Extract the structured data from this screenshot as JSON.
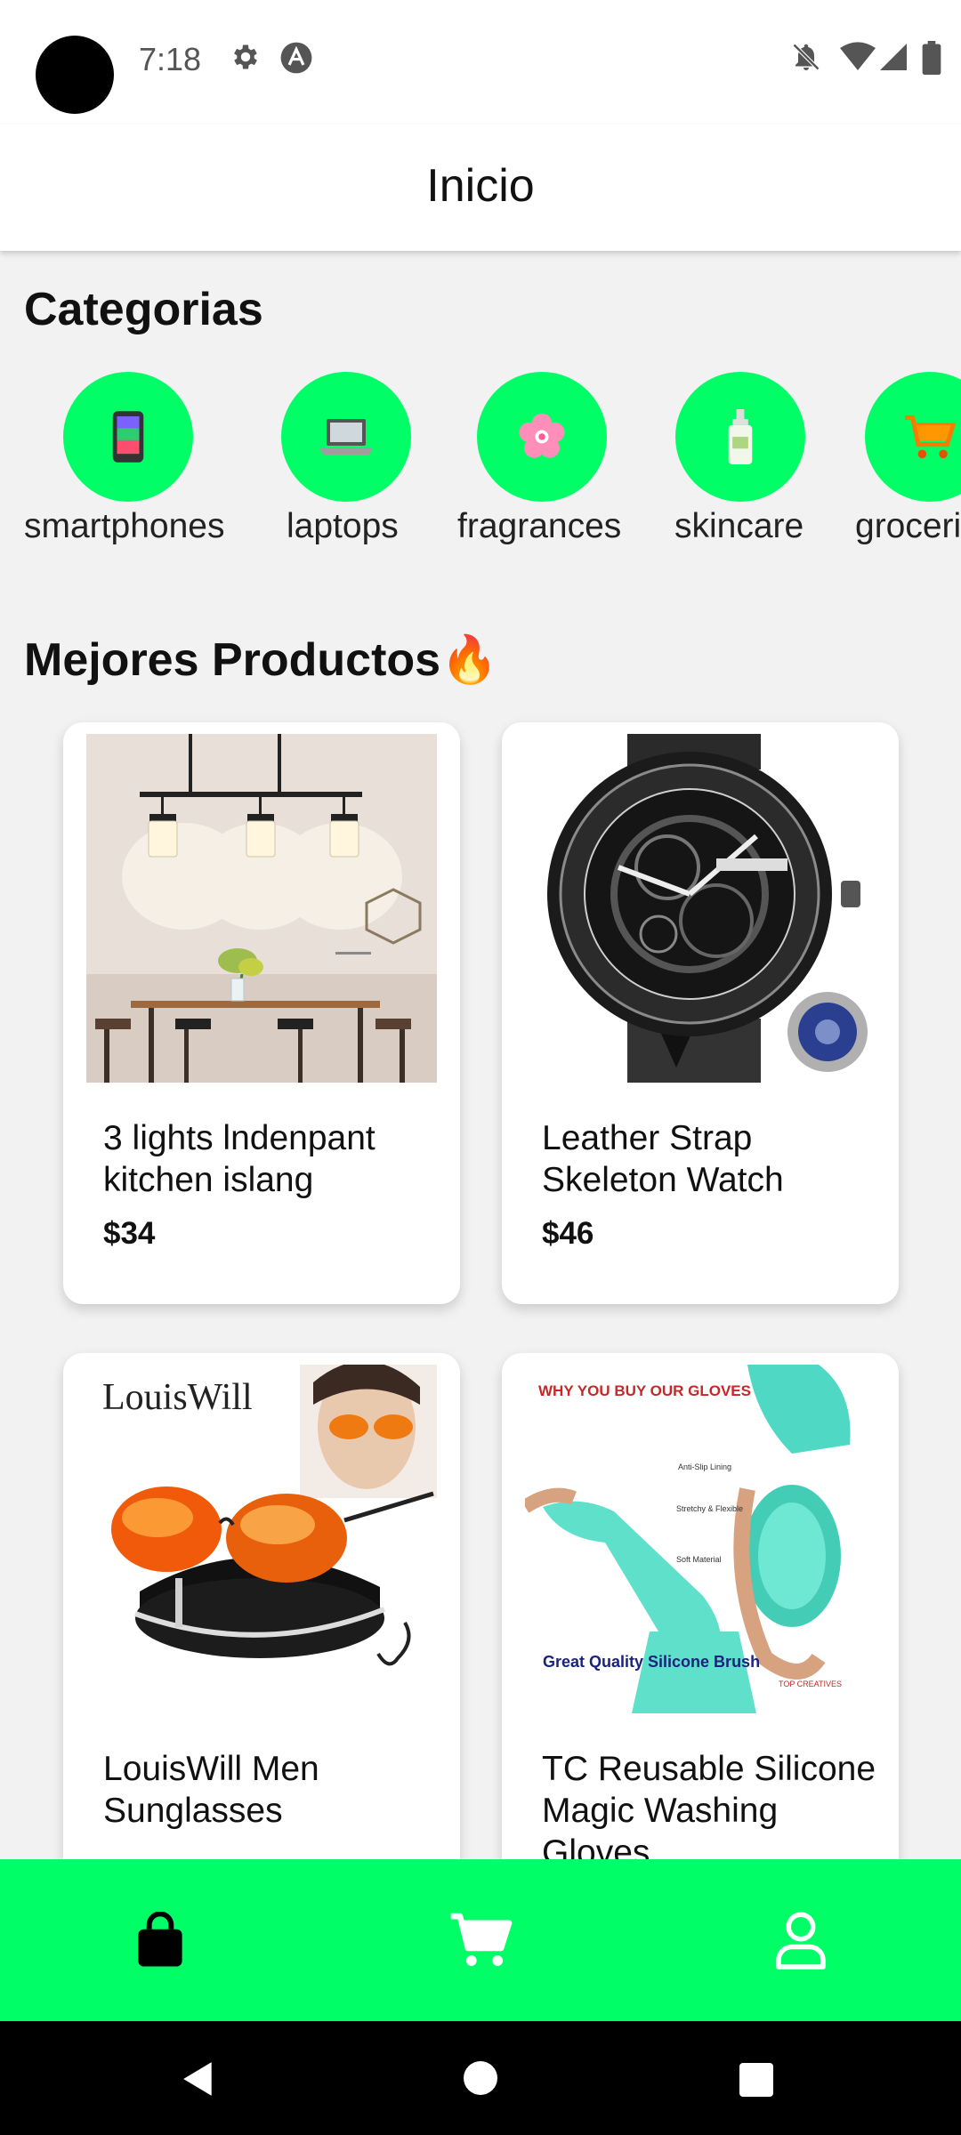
{
  "status_bar": {
    "time": "7:18",
    "left_icons": [
      "settings-icon",
      "app-notification-icon"
    ],
    "right_icons": [
      "notifications-off-icon",
      "wifi-icon",
      "signal-icon",
      "battery-icon"
    ]
  },
  "app_bar": {
    "title": "Inicio"
  },
  "categories": {
    "title": "Categorias",
    "items": [
      {
        "label": "smartphones",
        "icon": "smartphone-icon"
      },
      {
        "label": "laptops",
        "icon": "laptop-icon"
      },
      {
        "label": "fragrances",
        "icon": "flower-icon"
      },
      {
        "label": "skincare",
        "icon": "lotion-bottle-icon"
      },
      {
        "label": "groceri",
        "icon": "shopping-cart-icon"
      }
    ]
  },
  "products": {
    "title": "Mejores Productos🔥",
    "items": [
      {
        "title": "3 lights lndenpant kitchen islang",
        "price": "$34"
      },
      {
        "title": "Leather Strap Skeleton Watch",
        "price": "$46"
      },
      {
        "title": "LouisWill Men Sunglasses",
        "price": ""
      },
      {
        "title": "TC Reusable Silicone Magic Washing Gloves",
        "price": ""
      }
    ],
    "image_texts": {
      "brand_logo": "LouisWill",
      "gloves_heading": "WHY YOU BUY OUR GLOVES",
      "gloves_callouts": [
        "Anti-Slip Lining",
        "Stretchy & Flexible",
        "Soft Material"
      ],
      "gloves_badge": "Great Quality Silicone Brush",
      "gloves_brand": "TOP CREATIVES"
    }
  },
  "bottom_nav": {
    "items": [
      {
        "icon": "shopping-bag-icon",
        "active": true
      },
      {
        "icon": "cart-icon",
        "active": false
      },
      {
        "icon": "profile-icon",
        "active": false
      }
    ]
  },
  "system_nav": [
    "back-icon",
    "home-icon",
    "recents-icon"
  ],
  "colors": {
    "accent": "#00ff66",
    "background": "#f2f2f2",
    "text": "#111111"
  }
}
